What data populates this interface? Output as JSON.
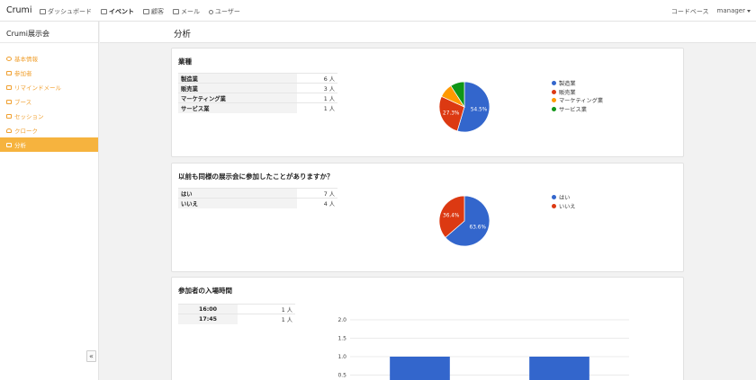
{
  "app": {
    "brand": "Crumi"
  },
  "nav": {
    "items": [
      {
        "label": "ダッシュボード"
      },
      {
        "label": "イベント"
      },
      {
        "label": "顧客"
      },
      {
        "label": "メール"
      },
      {
        "label": "ユーザー"
      }
    ],
    "codebase": "コードベース",
    "user": "manager"
  },
  "sidebar": {
    "title": "Crumi展示会",
    "items": [
      {
        "label": "基本情報"
      },
      {
        "label": "参加者"
      },
      {
        "label": "リマインドメール"
      },
      {
        "label": "ブース"
      },
      {
        "label": "セッション"
      },
      {
        "label": "クローク"
      },
      {
        "label": "分析"
      }
    ],
    "collapse": "«"
  },
  "page": {
    "title": "分析"
  },
  "industry": {
    "title": "業種",
    "rows": [
      {
        "key": "製造業",
        "value": "6 人"
      },
      {
        "key": "販売業",
        "value": "3 人"
      },
      {
        "key": "マーケティング業",
        "value": "1 人"
      },
      {
        "key": "サービス業",
        "value": "1 人"
      }
    ]
  },
  "previous": {
    "title": "以前も同様の展示会に参加したことがありますか？",
    "rows": [
      {
        "key": "はい",
        "value": "7 人"
      },
      {
        "key": "いいえ",
        "value": "4 人"
      }
    ]
  },
  "entry": {
    "title": "参加者の入場時間",
    "rows": [
      {
        "key": "16:00",
        "value": "1 人"
      },
      {
        "key": "17:45",
        "value": "1 人"
      }
    ]
  },
  "colors": {
    "blue": "#3366cc",
    "red": "#dc3912",
    "orange": "#ff9900",
    "green": "#109618",
    "accent": "#f6b33e"
  },
  "chart_data": [
    {
      "type": "pie",
      "labels": [
        "製造業",
        "販売業",
        "マーケティング業",
        "サービス業"
      ],
      "values": [
        6,
        3,
        1,
        1
      ],
      "slice_labels": [
        "54.5%",
        "27.3%",
        "",
        ""
      ],
      "colors": [
        "#3366cc",
        "#dc3912",
        "#ff9900",
        "#109618"
      ],
      "legend": "right"
    },
    {
      "type": "pie",
      "labels": [
        "はい",
        "いいえ"
      ],
      "values": [
        7,
        4
      ],
      "slice_labels": [
        "63.6%",
        "36.4%"
      ],
      "colors": [
        "#3366cc",
        "#dc3912"
      ],
      "legend": "right"
    },
    {
      "type": "bar",
      "categories": [
        "16:00",
        "17:45"
      ],
      "values": [
        1,
        1
      ],
      "ylim": [
        0,
        2
      ],
      "yticks": [
        "0.5",
        "1.0",
        "1.5",
        "2.0"
      ],
      "color": "#3366cc",
      "grid": true
    }
  ]
}
